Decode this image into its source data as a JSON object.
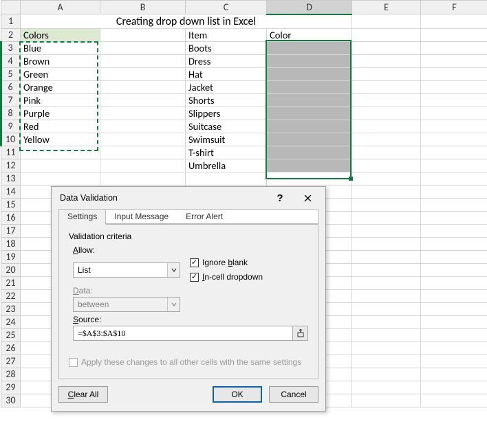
{
  "columns": [
    "A",
    "B",
    "C",
    "D",
    "E",
    "F"
  ],
  "rows": [
    "1",
    "2",
    "3",
    "4",
    "5",
    "6",
    "7",
    "8",
    "9",
    "10",
    "11",
    "12",
    "13",
    "14",
    "15",
    "16",
    "17",
    "18",
    "19",
    "20",
    "21",
    "22",
    "23",
    "24",
    "25",
    "26",
    "27",
    "28",
    "29",
    "30"
  ],
  "title": "Creating drop down list in Excel",
  "headers": {
    "A2": "Colors",
    "C2": "Item",
    "D2": "Color"
  },
  "colA": [
    "Blue",
    "Brown",
    "Green",
    "Orange",
    "Pink",
    "Purple",
    "Red",
    "Yellow"
  ],
  "colC": [
    "Boots",
    "Dress",
    "Hat",
    "Jacket",
    "Shorts",
    "Slippers",
    "Suitcase",
    "Swimsuit",
    "T-shirt",
    "Umbrella"
  ],
  "dialog": {
    "title": "Data Validation",
    "tabs": [
      "Settings",
      "Input Message",
      "Error Alert"
    ],
    "criteria_label": "Validation criteria",
    "allow_label": "Allow:",
    "allow_value": "List",
    "data_label": "Data:",
    "data_value": "between",
    "ignore_blank": "Ignore blank",
    "incell_dropdown": "In-cell dropdown",
    "source_label": "Source:",
    "source_value": "=$A$3:$A$10",
    "apply_all": "Apply these changes to all other cells with the same settings",
    "clear_all": "Clear All",
    "ok": "OK",
    "cancel": "Cancel"
  }
}
